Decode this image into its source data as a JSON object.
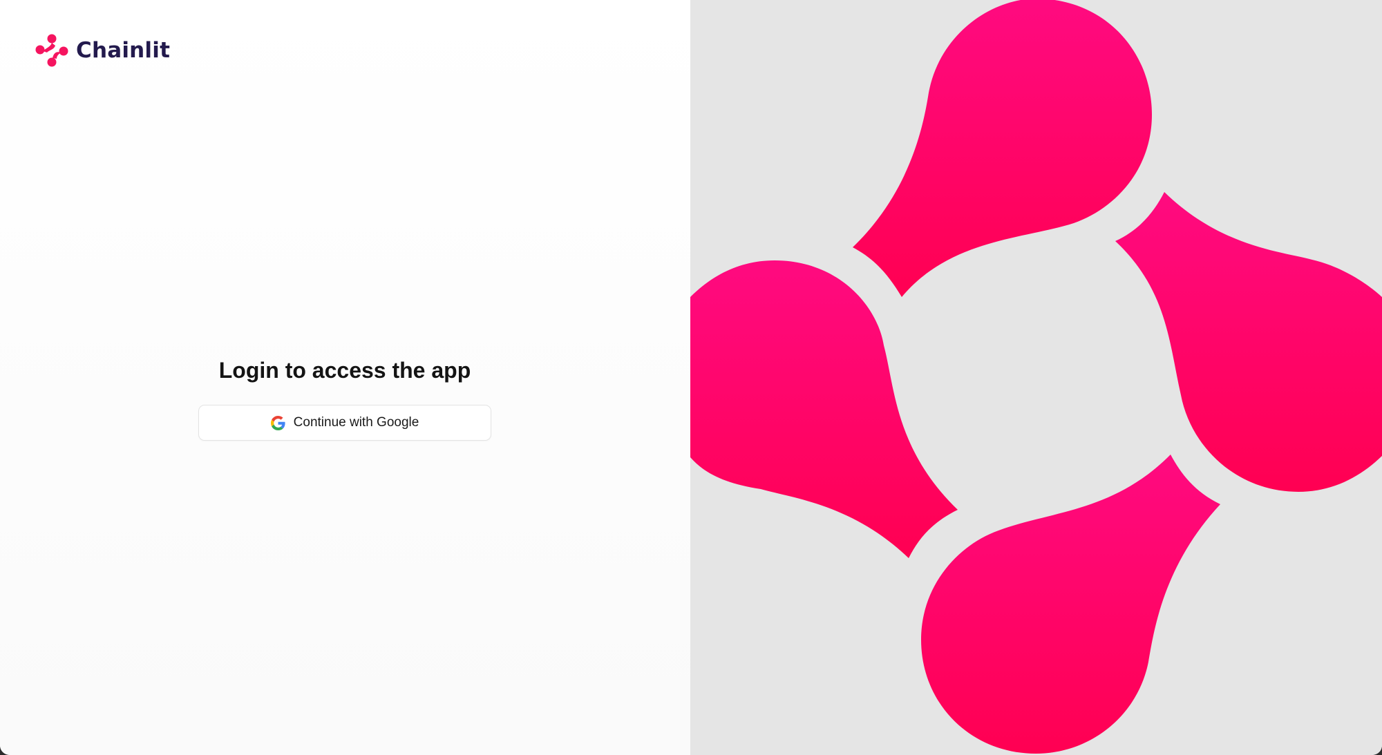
{
  "brand": {
    "name": "Chainlit",
    "logo_icon": "chainlit-logo-icon",
    "accent_color": "#f5145f",
    "text_color": "#231a4d"
  },
  "login": {
    "title": "Login to access the app",
    "google_button_label": "Continue with Google",
    "google_icon": "google-g-icon"
  },
  "hero": {
    "icon": "chainlit-logo-icon",
    "background_color": "#e5e5e5",
    "gradient_top": "#ff0a80",
    "gradient_bottom": "#ff0052"
  }
}
